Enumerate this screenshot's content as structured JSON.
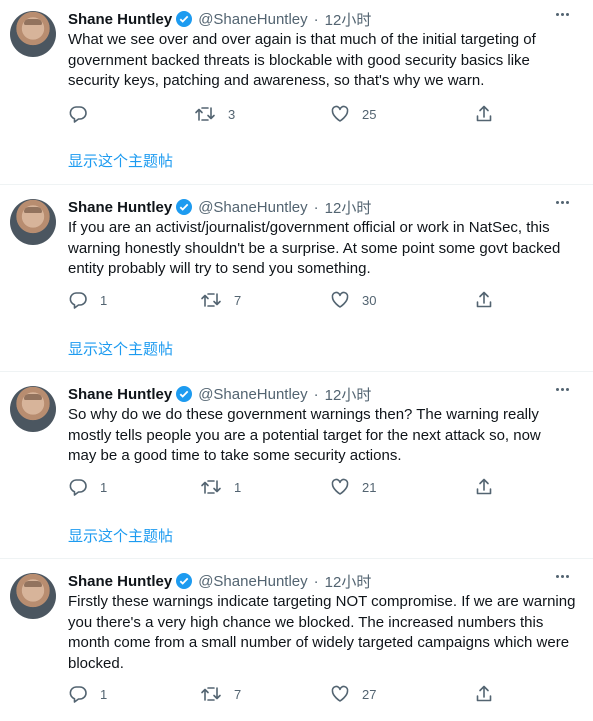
{
  "show_thread_label": "显示这个主题帖",
  "tweets": [
    {
      "name": "Shane Huntley",
      "handle": "@ShaneHuntley",
      "time": "12小时",
      "lines": [
        "What we see over and over again is that much of the initial targeting of",
        "government backed threats is blockable with good security basics like",
        "security keys, patching and awareness, so that's why we warn."
      ],
      "reply_count": "",
      "retweet_count": "3",
      "like_count": "25"
    },
    {
      "name": "Shane Huntley",
      "handle": "@ShaneHuntley",
      "time": "12小时",
      "lines": [
        "If you are an activist/journalist/government official or work in NatSec, this",
        "warning honestly shouldn't be a surprise. At some point some govt backed",
        "entity probably will try to send you something."
      ],
      "reply_count": "1",
      "retweet_count": "7",
      "like_count": "30"
    },
    {
      "name": "Shane Huntley",
      "handle": "@ShaneHuntley",
      "time": "12小时",
      "lines": [
        "So why do we do these government warnings then? The warning really",
        "mostly tells people you are a potential target for the next attack so, now",
        "may be a good time to take some security actions."
      ],
      "reply_count": "1",
      "retweet_count": "1",
      "like_count": "21"
    },
    {
      "name": "Shane Huntley",
      "handle": "@ShaneHuntley",
      "time": "12小时",
      "lines": [
        "Firstly these warnings indicate targeting NOT compromise. If we are warning",
        "you there's a very high chance we blocked. The increased numbers this",
        "month come from a small number of widely targeted campaigns which were",
        "blocked."
      ],
      "reply_count": "1",
      "retweet_count": "7",
      "like_count": "27"
    }
  ]
}
